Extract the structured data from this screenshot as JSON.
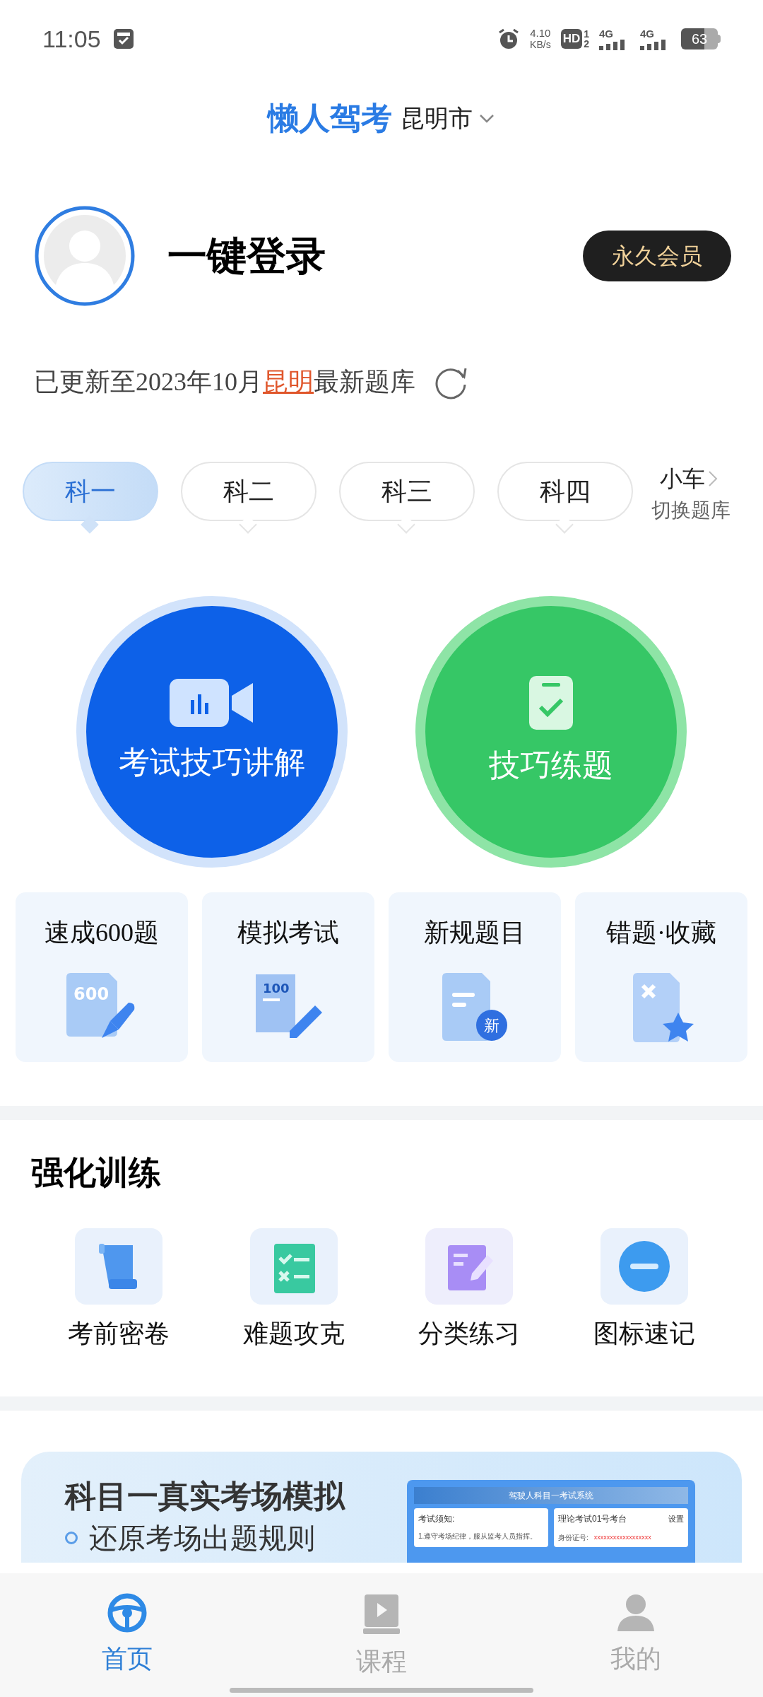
{
  "status_bar": {
    "time": "11:05",
    "speed_value": "4.10",
    "speed_unit": "KB/s",
    "hd": "HD",
    "sim_slots": [
      "1",
      "2"
    ],
    "networks": [
      "4G",
      "4G"
    ],
    "battery": "63"
  },
  "header": {
    "app_name": "懒人驾考",
    "city": "昆明市"
  },
  "profile": {
    "login": "一键登录",
    "vip_badge": "永久会员"
  },
  "update_notice": {
    "prefix": "已更新至2023年10月",
    "city": "昆明",
    "suffix": "最新题库"
  },
  "subject_tabs": [
    {
      "label": "科一",
      "selected": true
    },
    {
      "label": "科二",
      "selected": false
    },
    {
      "label": "科三",
      "selected": false
    },
    {
      "label": "科四",
      "selected": false
    }
  ],
  "vehicle_switch": {
    "vehicle": "小车",
    "hint": "切换题库"
  },
  "main_actions": [
    {
      "label": "考试技巧讲解",
      "kind": "video"
    },
    {
      "label": "技巧练题",
      "kind": "practice"
    }
  ],
  "quick_cards": [
    {
      "label": "速成600题",
      "kind": "rocket",
      "icon_text": "600"
    },
    {
      "label": "模拟考试",
      "kind": "exam",
      "icon_text": "100"
    },
    {
      "label": "新规题目",
      "kind": "new",
      "icon_text": "新"
    },
    {
      "label": "错题·收藏",
      "kind": "wrong"
    }
  ],
  "training": {
    "title": "强化训练",
    "items": [
      {
        "label": "考前密卷",
        "kind": "scroll"
      },
      {
        "label": "难题攻克",
        "kind": "checklist"
      },
      {
        "label": "分类练习",
        "kind": "edit"
      },
      {
        "label": "图标速记",
        "kind": "sign"
      }
    ]
  },
  "banner": {
    "title": "科目一真实考场模拟",
    "bullet": "还原考场出题规则",
    "preview": {
      "system_title": "驾驶人科目一考试系统",
      "notice_title": "考试须知:",
      "notice_line": "1.遵守考场纪律，服从监考人员指挥。",
      "station": "理论考试01号考台",
      "settings": "设置",
      "id_label": "身份证号:",
      "id_value": "xxxxxxxxxxxxxxxxxx"
    }
  },
  "bottom_nav": [
    {
      "label": "首页",
      "kind": "home",
      "selected": true
    },
    {
      "label": "课程",
      "kind": "course",
      "selected": false
    },
    {
      "label": "我的",
      "kind": "profile",
      "selected": false
    }
  ]
}
